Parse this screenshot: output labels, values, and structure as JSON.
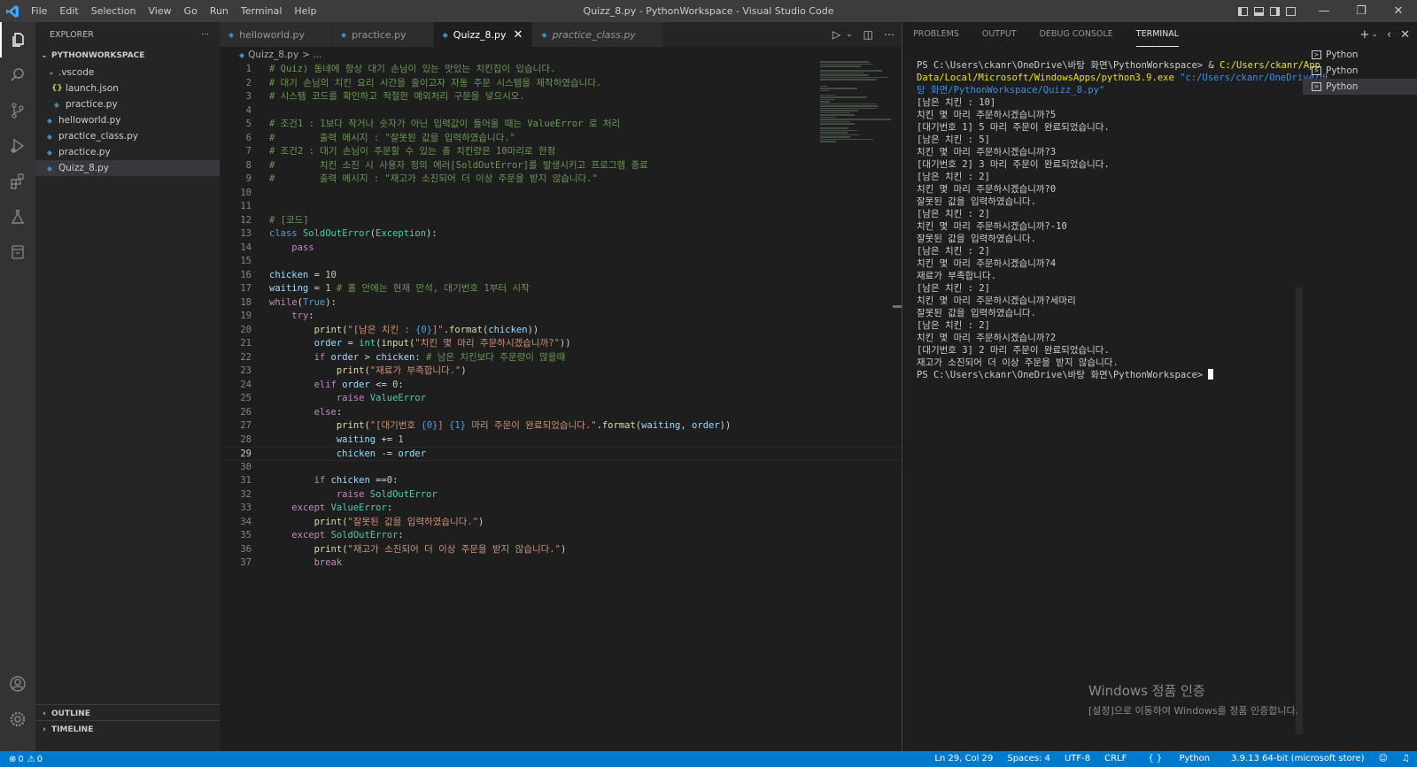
{
  "titlebar": {
    "menu": [
      "File",
      "Edit",
      "Selection",
      "View",
      "Go",
      "Run",
      "Terminal",
      "Help"
    ],
    "title": "Quizz_8.py - PythonWorkspace - Visual Studio Code"
  },
  "sidebar": {
    "header": "EXPLORER",
    "more": "···",
    "workspace": "PYTHONWORKSPACE",
    "tree": [
      {
        "label": ".vscode",
        "type": "folder",
        "depth": 1
      },
      {
        "label": "launch.json",
        "type": "json",
        "depth": 2
      },
      {
        "label": "practice.py",
        "type": "py",
        "depth": 2
      },
      {
        "label": "helloworld.py",
        "type": "py",
        "depth": 1
      },
      {
        "label": "practice_class.py",
        "type": "py",
        "depth": 1
      },
      {
        "label": "practice.py",
        "type": "py",
        "depth": 1
      },
      {
        "label": "Quizz_8.py",
        "type": "py",
        "depth": 1,
        "selected": true
      }
    ],
    "outline": "OUTLINE",
    "timeline": "TIMELINE"
  },
  "tabs": [
    {
      "label": "helloworld.py",
      "active": false
    },
    {
      "label": "practice.py",
      "active": false
    },
    {
      "label": "Quizz_8.py",
      "active": true
    },
    {
      "label": "practice_class.py",
      "active": false,
      "italic": true
    }
  ],
  "breadcrumb": {
    "file": "Quizz_8.py",
    "rest": "> ..."
  },
  "editor": {
    "current_line": 29,
    "lines": [
      [
        [
          "c",
          "# Quiz) 동네에 항상 대기 손님이 있는 맛있는 치킨집이 있습니다."
        ]
      ],
      [
        [
          "c",
          "# 대기 손님의 치킨 요리 시간을 줄이고자 자동 주문 시스템을 제작하였습니다."
        ]
      ],
      [
        [
          "c",
          "# 시스템 코드를 확인하고 적절한 예외처리 구문을 넣으시오."
        ]
      ],
      [],
      [
        [
          "c",
          "# 조건1 : 1보다 작거나 숫자가 아닌 입력값이 들어올 때는 ValueError 로 처리"
        ]
      ],
      [
        [
          "c",
          "#        출력 메시지 : \"잘못된 값을 입력하였습니다.\""
        ]
      ],
      [
        [
          "c",
          "# 조건2 : 대기 손님이 주문할 수 있는 총 치킨량은 10마리로 한정"
        ]
      ],
      [
        [
          "c",
          "#        치킨 소진 시 사용자 정의 에러[SoldOutError]를 발생시키고 프로그램 종료"
        ]
      ],
      [
        [
          "c",
          "#        출력 메시지 : \"재고가 소진되어 더 이상 주문을 받지 않습니다.\""
        ]
      ],
      [],
      [],
      [
        [
          "c",
          "# [코드]"
        ]
      ],
      [
        [
          "k",
          "class "
        ],
        [
          "t",
          "SoldOutError"
        ],
        [
          "p",
          "("
        ],
        [
          "t",
          "Exception"
        ],
        [
          "p",
          "):"
        ]
      ],
      [
        [
          "p",
          "    "
        ],
        [
          "f",
          "pass"
        ]
      ],
      [],
      [
        [
          "v",
          "chicken"
        ],
        [
          "p",
          " = "
        ],
        [
          "n",
          "10"
        ]
      ],
      [
        [
          "v",
          "waiting"
        ],
        [
          "p",
          " = "
        ],
        [
          "n",
          "1"
        ],
        [
          "c",
          " # 홀 안에는 현재 만석, 대기번호 1부터 시작"
        ]
      ],
      [
        [
          "f",
          "while"
        ],
        [
          "p",
          "("
        ],
        [
          "k",
          "True"
        ],
        [
          "p",
          "):"
        ]
      ],
      [
        [
          "p",
          "    "
        ],
        [
          "f",
          "try"
        ],
        [
          "p",
          ":"
        ]
      ],
      [
        [
          "p",
          "        "
        ],
        [
          "y",
          "print"
        ],
        [
          "p",
          "("
        ],
        [
          "s",
          "\"[남은 치킨 : "
        ],
        [
          "k",
          "{0}"
        ],
        [
          "s",
          "]\""
        ],
        [
          "p",
          "."
        ],
        [
          "y",
          "format"
        ],
        [
          "p",
          "("
        ],
        [
          "v",
          "chicken"
        ],
        [
          "p",
          "))"
        ]
      ],
      [
        [
          "p",
          "        "
        ],
        [
          "v",
          "order"
        ],
        [
          "p",
          " = "
        ],
        [
          "t",
          "int"
        ],
        [
          "p",
          "("
        ],
        [
          "y",
          "input"
        ],
        [
          "p",
          "("
        ],
        [
          "s",
          "\"치킨 몇 마리 주문하시겠습니까?\""
        ],
        [
          "p",
          "))"
        ]
      ],
      [
        [
          "p",
          "        "
        ],
        [
          "f",
          "if "
        ],
        [
          "v",
          "order"
        ],
        [
          "p",
          " > "
        ],
        [
          "v",
          "chicken"
        ],
        [
          "p",
          ": "
        ],
        [
          "c",
          "# 남은 치킨보다 주문량이 많을때"
        ]
      ],
      [
        [
          "p",
          "            "
        ],
        [
          "y",
          "print"
        ],
        [
          "p",
          "("
        ],
        [
          "s",
          "\"재료가 부족합니다.\""
        ],
        [
          "p",
          ")"
        ]
      ],
      [
        [
          "p",
          "        "
        ],
        [
          "f",
          "elif "
        ],
        [
          "v",
          "order"
        ],
        [
          "p",
          " <= "
        ],
        [
          "n",
          "0"
        ],
        [
          "p",
          ":"
        ]
      ],
      [
        [
          "p",
          "            "
        ],
        [
          "f",
          "raise "
        ],
        [
          "t",
          "ValueError"
        ]
      ],
      [
        [
          "p",
          "        "
        ],
        [
          "f",
          "else"
        ],
        [
          "p",
          ":"
        ]
      ],
      [
        [
          "p",
          "            "
        ],
        [
          "y",
          "print"
        ],
        [
          "p",
          "("
        ],
        [
          "s",
          "\"[대기번호 "
        ],
        [
          "k",
          "{0}"
        ],
        [
          "s",
          "] "
        ],
        [
          "k",
          "{1}"
        ],
        [
          "s",
          " 마리 주문이 완료되었습니다.\""
        ],
        [
          "p",
          "."
        ],
        [
          "y",
          "format"
        ],
        [
          "p",
          "("
        ],
        [
          "v",
          "waiting"
        ],
        [
          "p",
          ", "
        ],
        [
          "v",
          "order"
        ],
        [
          "p",
          "))"
        ]
      ],
      [
        [
          "p",
          "            "
        ],
        [
          "v",
          "waiting"
        ],
        [
          "p",
          " += "
        ],
        [
          "n",
          "1"
        ]
      ],
      [
        [
          "p",
          "            "
        ],
        [
          "v",
          "chicken"
        ],
        [
          "p",
          " -= "
        ],
        [
          "v",
          "order"
        ]
      ],
      [],
      [
        [
          "p",
          "        "
        ],
        [
          "f",
          "if "
        ],
        [
          "v",
          "chicken"
        ],
        [
          "p",
          " =="
        ],
        [
          "n",
          "0"
        ],
        [
          "p",
          ":"
        ]
      ],
      [
        [
          "p",
          "            "
        ],
        [
          "f",
          "raise "
        ],
        [
          "t",
          "SoldOutError"
        ]
      ],
      [
        [
          "p",
          "    "
        ],
        [
          "f",
          "except "
        ],
        [
          "t",
          "ValueError"
        ],
        [
          "p",
          ":"
        ]
      ],
      [
        [
          "p",
          "        "
        ],
        [
          "y",
          "print"
        ],
        [
          "p",
          "("
        ],
        [
          "s",
          "\"잘못된 값을 입력하였습니다.\""
        ],
        [
          "p",
          ")"
        ]
      ],
      [
        [
          "p",
          "    "
        ],
        [
          "f",
          "except "
        ],
        [
          "t",
          "SoldOutError"
        ],
        [
          "p",
          ":"
        ]
      ],
      [
        [
          "p",
          "        "
        ],
        [
          "y",
          "print"
        ],
        [
          "p",
          "("
        ],
        [
          "s",
          "\"재고가 소진되어 더 이상 주문을 받지 않습니다.\""
        ],
        [
          "p",
          ")"
        ]
      ],
      [
        [
          "p",
          "        "
        ],
        [
          "f",
          "break"
        ]
      ]
    ]
  },
  "panel": {
    "tabs": [
      "PROBLEMS",
      "OUTPUT",
      "DEBUG CONSOLE",
      "TERMINAL"
    ],
    "active_tab": "TERMINAL",
    "terminal_lines": [
      [
        [
          "w",
          "PS C:\\Users\\ckanr\\OneDrive\\바탕 화면\\PythonWorkspace> & "
        ],
        [
          "y",
          "C:/Users/ckanr/App"
        ]
      ],
      [
        [
          "y",
          "Data/Local/Microsoft/WindowsApps/python3.9.exe "
        ],
        [
          "b",
          "\"c:/Users/ckanr/OneDrive/바"
        ]
      ],
      [
        [
          "b",
          "탕 화면/PythonWorkspace/Quizz_8.py\""
        ]
      ],
      [
        [
          "w",
          "[남은 치킨 : 10]"
        ]
      ],
      [
        [
          "w",
          "치킨 몇 마리 주문하시겠습니까?5"
        ]
      ],
      [
        [
          "w",
          "[대기번호 1] 5 마리 주문이 완료되었습니다."
        ]
      ],
      [
        [
          "w",
          "[남은 치킨 : 5]"
        ]
      ],
      [
        [
          "w",
          "치킨 몇 마리 주문하시겠습니까?3"
        ]
      ],
      [
        [
          "w",
          "[대기번호 2] 3 마리 주문이 완료되었습니다."
        ]
      ],
      [
        [
          "w",
          "[남은 치킨 : 2]"
        ]
      ],
      [
        [
          "w",
          "치킨 몇 마리 주문하시겠습니까?0"
        ]
      ],
      [
        [
          "w",
          "잘못된 값을 입력하였습니다."
        ]
      ],
      [
        [
          "w",
          "[남은 치킨 : 2]"
        ]
      ],
      [
        [
          "w",
          "치킨 몇 마리 주문하시겠습니까?-10"
        ]
      ],
      [
        [
          "w",
          "잘못된 값을 입력하였습니다."
        ]
      ],
      [
        [
          "w",
          "[남은 치킨 : 2]"
        ]
      ],
      [
        [
          "w",
          "치킨 몇 마리 주문하시겠습니까?4"
        ]
      ],
      [
        [
          "w",
          "재료가 부족합니다."
        ]
      ],
      [
        [
          "w",
          "[남은 치킨 : 2]"
        ]
      ],
      [
        [
          "w",
          "치킨 몇 마리 주문하시겠습니까?세마리"
        ]
      ],
      [
        [
          "w",
          "잘못된 값을 입력하였습니다."
        ]
      ],
      [
        [
          "w",
          "[남은 치킨 : 2]"
        ]
      ],
      [
        [
          "w",
          "치킨 몇 마리 주문하시겠습니까?2"
        ]
      ],
      [
        [
          "w",
          "[대기번호 3] 2 마리 주문이 완료되었습니다."
        ]
      ],
      [
        [
          "w",
          "재고가 소진되어 더 이상 주문을 받지 않습니다."
        ]
      ],
      [
        [
          "w",
          "PS C:\\Users\\ckanr\\OneDrive\\바탕 화면\\PythonWorkspace> "
        ],
        [
          "cursor",
          ""
        ]
      ]
    ],
    "terminals": [
      {
        "label": "Python",
        "active": false
      },
      {
        "label": "Python",
        "active": false
      },
      {
        "label": "Python",
        "active": true
      }
    ],
    "watermark": {
      "line1": "Windows 정품 인증",
      "line2": "[설정]으로 이동하여 Windows를 정품 인증합니다."
    }
  },
  "statusbar": {
    "errors": "0",
    "warnings": "0",
    "position": "Ln 29, Col 29",
    "spaces": "Spaces: 4",
    "encoding": "UTF-8",
    "eol": "CRLF",
    "language": "Python",
    "interpreter": "3.9.13 64-bit (microsoft store)"
  },
  "colors": {
    "statusbar": "#007acc",
    "activitybar": "#333333",
    "sidebar": "#252526",
    "editor": "#1e1e1e",
    "titlebar": "#3c3c3c"
  }
}
